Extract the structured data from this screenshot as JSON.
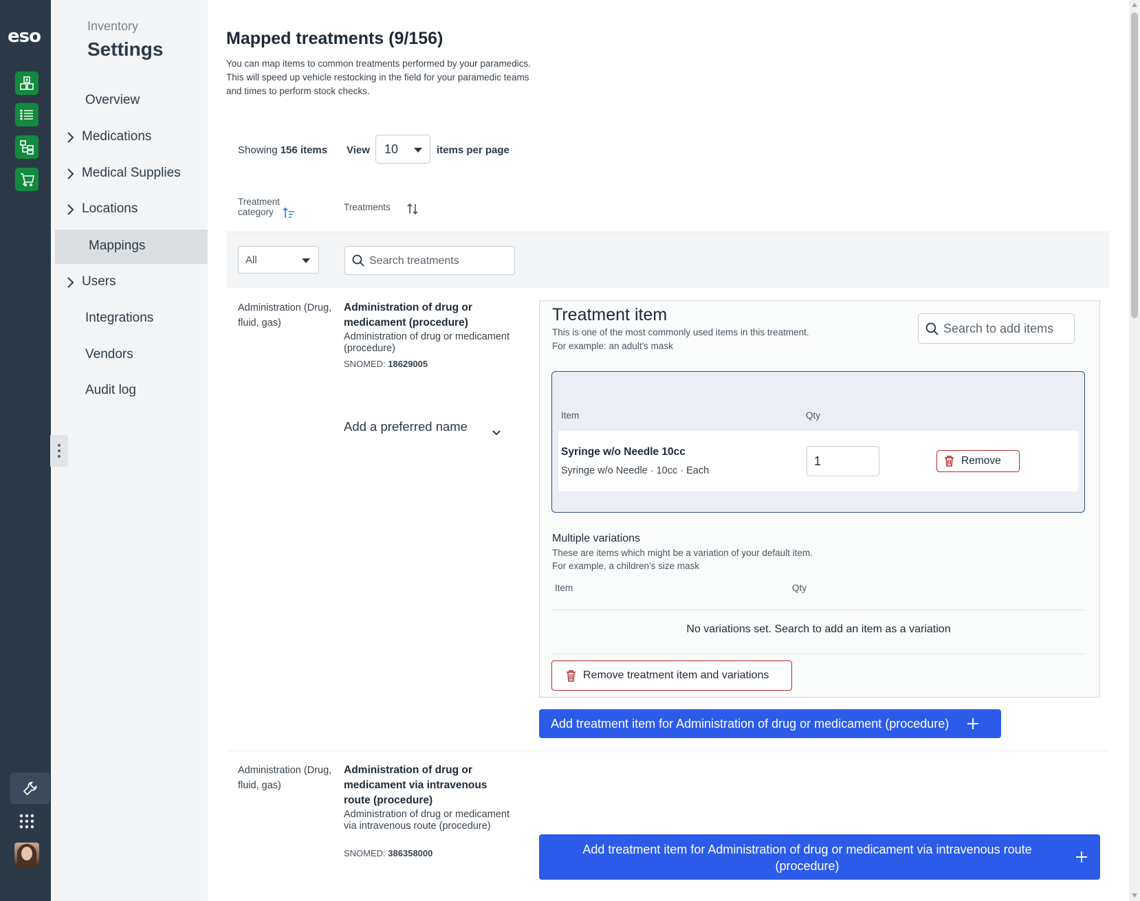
{
  "app": {
    "logo": "eso"
  },
  "rail": {
    "icons": [
      "inventory-grid-icon",
      "list-icon",
      "hierarchy-icon",
      "cart-icon"
    ],
    "tools_icon": "wrench-icon",
    "apps_icon": "app-grid-icon"
  },
  "sidebar": {
    "subtitle": "Inventory",
    "title": "Settings",
    "items": [
      {
        "label": "Overview"
      },
      {
        "label": "Medications"
      },
      {
        "label": "Medical Supplies"
      },
      {
        "label": "Locations"
      },
      {
        "label": "Mappings"
      },
      {
        "label": "Users"
      },
      {
        "label": "Integrations"
      },
      {
        "label": "Vendors"
      },
      {
        "label": "Audit log"
      }
    ],
    "active": "Mappings"
  },
  "main": {
    "title": "Mapped treatments (9/156)",
    "description": "You can map items to common treatments performed by your paramedics. This will speed up vehicle restocking in the field for your paramedic teams and times to perform stock checks.",
    "showing_prefix": "Showing",
    "showing_count": "156 items",
    "view_label": "View",
    "per_page_value": "10",
    "per_page_label": "items per page",
    "columns": {
      "category": "Treatment category",
      "treatments": "Treatments"
    },
    "filters": {
      "category_value": "All",
      "search_placeholder": "Search treatments"
    },
    "rows": [
      {
        "category": "Administration (Drug, fluid, gas)",
        "name": "Administration of drug or medicament (procedure)",
        "description": "Administration of drug or medicament (procedure)",
        "snomed_label": "SNOMED:",
        "snomed_code": "18629005",
        "preferred_name": "Add a preferred name",
        "add_button": "Add treatment item for Administration of drug or medicament (procedure)"
      },
      {
        "category": "Administration (Drug, fluid, gas)",
        "name": "Administration of drug or medicament via intravenous route (procedure)",
        "description": "Administration of drug or medicament via intravenous route (procedure)",
        "snomed_label": "SNOMED:",
        "snomed_code": "386358000",
        "add_button": "Add treatment item for Administration of drug or medicament via intravenous route (procedure)"
      }
    ],
    "treatment_item": {
      "title": "Treatment item",
      "description_line1": "This is one of the most commonly used items in this treatment.",
      "description_line2": "For example: an adult's mask",
      "search_placeholder": "Search to add items",
      "col_item": "Item",
      "col_qty": "Qty",
      "item_name": "Syringe w/o Needle 10cc",
      "item_sub": "Syringe w/o Needle · 10cc · Each",
      "qty_value": "1",
      "remove_label": "Remove"
    },
    "variations": {
      "title": "Multiple variations",
      "description_line1": "These are items which might be a variation of your default item.",
      "description_line2": "For example, a children's size mask",
      "col_item": "Item",
      "col_qty": "Qty",
      "empty": "No variations set. Search to add an item as a variation",
      "remove_all_label": "Remove treatment item and variations"
    }
  },
  "colors": {
    "rail": "#2c3a48",
    "rail_button": "#138a3f",
    "primary": "#2b5be8",
    "danger": "#b42a2a"
  }
}
